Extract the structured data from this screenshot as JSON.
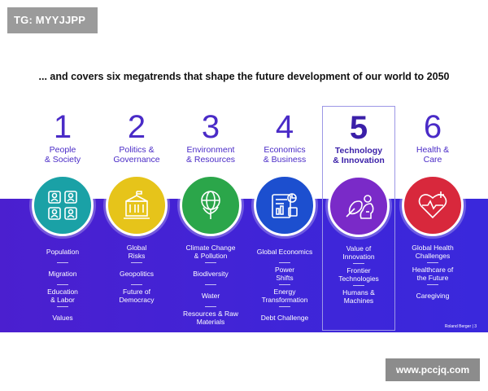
{
  "badge": "TG: MYYJJPP",
  "headline": "... and covers six megatrends that shape the future development of our world to 2050",
  "colors": {
    "band": "#4024d6",
    "accent": "#4a2bc7",
    "c1": "#1aa1a6",
    "c2": "#e6c41a",
    "c3": "#2ba64a",
    "c4": "#1c4fcf",
    "c5": "#7a2ac8",
    "c6": "#d8283c"
  },
  "trends": [
    {
      "number": "1",
      "title_line1": "People",
      "title_line2": "& Society",
      "icon": "people-icon",
      "items": [
        [
          "Population",
          ""
        ],
        [
          "Migration",
          ""
        ],
        [
          "Education",
          "& Labor"
        ],
        [
          "Values",
          ""
        ]
      ]
    },
    {
      "number": "2",
      "title_line1": "Politics &",
      "title_line2": "Governance",
      "icon": "building-icon",
      "items": [
        [
          "Global",
          "Risks"
        ],
        [
          "Geopolitics",
          ""
        ],
        [
          "Future of",
          "Democracy"
        ]
      ]
    },
    {
      "number": "3",
      "title_line1": "Environment",
      "title_line2": "& Resources",
      "icon": "globe-tree-icon",
      "items": [
        [
          "Climate Change",
          "& Pollution"
        ],
        [
          "Biodiversity",
          ""
        ],
        [
          "Water",
          ""
        ],
        [
          "Resources & Raw",
          "Materials"
        ]
      ]
    },
    {
      "number": "4",
      "title_line1": "Economics",
      "title_line2": "& Business",
      "icon": "chart-document-icon",
      "items": [
        [
          "Global Economics",
          ""
        ],
        [
          "Power",
          "Shifts"
        ],
        [
          "Energy",
          "Transformation"
        ],
        [
          "Debt Challenge",
          ""
        ]
      ]
    },
    {
      "number": "5",
      "title_line1": "Technology",
      "title_line2": "& Innovation",
      "icon": "rocket-head-icon",
      "items": [
        [
          "Value of",
          "Innovation"
        ],
        [
          "Frontier",
          "Technologies"
        ],
        [
          "Humans &",
          "Machines"
        ]
      ]
    },
    {
      "number": "6",
      "title_line1": "Health &",
      "title_line2": "Care",
      "icon": "heart-pulse-icon",
      "items": [
        [
          "Global Health",
          "Challenges"
        ],
        [
          "Healthcare of",
          "the Future"
        ],
        [
          "Caregiving",
          ""
        ]
      ]
    }
  ],
  "footer": "Roland Berger  |  3",
  "watermark": "www.pccjq.com"
}
